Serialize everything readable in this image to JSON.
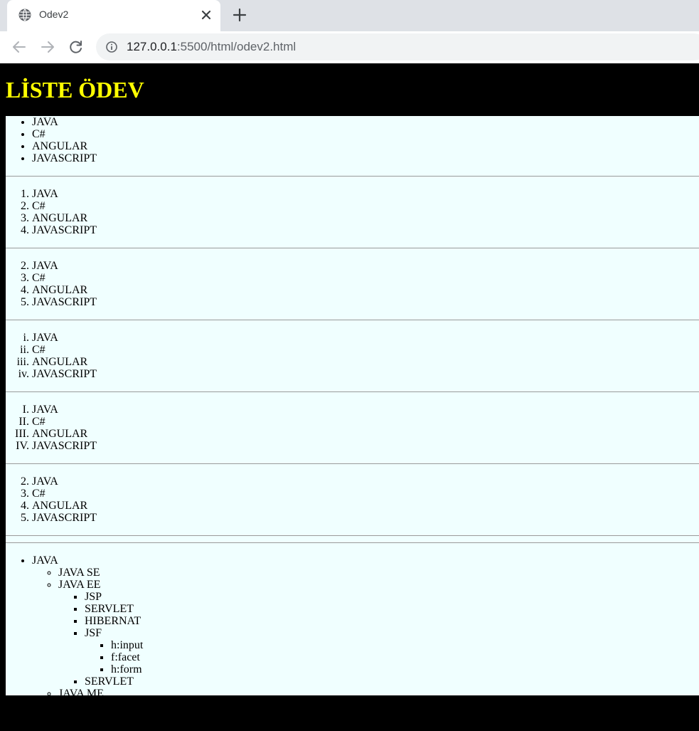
{
  "browser": {
    "tab_title": "Odev2",
    "url_host": "127.0.0.1",
    "url_rest": ":5500/html/odev2.html"
  },
  "page": {
    "title": "LİSTE ÖDEV"
  },
  "lists": {
    "items": [
      "JAVA",
      "C#",
      "ANGULAR",
      "JAVASCRIPT"
    ],
    "decimal_start": 1,
    "decimal_start_2": 2,
    "decimal_start_3": 2
  },
  "nested": {
    "root": "JAVA",
    "java_se": "JAVA SE",
    "java_ee": "JAVA EE",
    "ee_items": [
      "JSP",
      "SERVLET",
      "HIBERNAT",
      "JSF"
    ],
    "jsf_items": [
      "h:input",
      "f:facet",
      "h:form"
    ],
    "ee_after_jsf": "SERVLET",
    "java_me": "JAVA ME"
  }
}
